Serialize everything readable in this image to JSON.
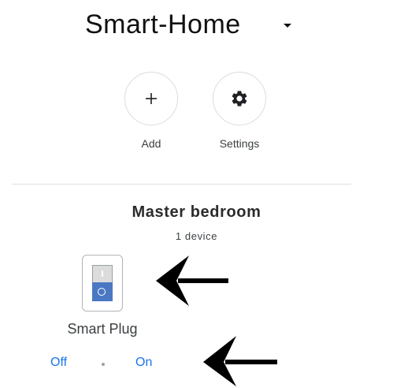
{
  "header": {
    "home_name": "Smart-Home",
    "dropdown_icon": "caret-down-icon"
  },
  "actions": [
    {
      "label": "Add",
      "icon": "plus-icon"
    },
    {
      "label": "Settings",
      "icon": "gear-icon"
    }
  ],
  "room": {
    "name": "Master bedroom",
    "device_count": "1 device"
  },
  "device": {
    "name": "Smart Plug",
    "icon": "rocker-switch-icon",
    "off_label": "Off",
    "on_label": "On",
    "accent_color": "#4a78c2"
  },
  "colors": {
    "link": "#1a73e8",
    "divider": "#e0e0e0",
    "circle_border": "#dadce0"
  },
  "annotations": [
    {
      "icon": "left-arrow-icon",
      "points_to": "device"
    },
    {
      "icon": "left-arrow-icon",
      "points_to": "power-controls"
    }
  ]
}
